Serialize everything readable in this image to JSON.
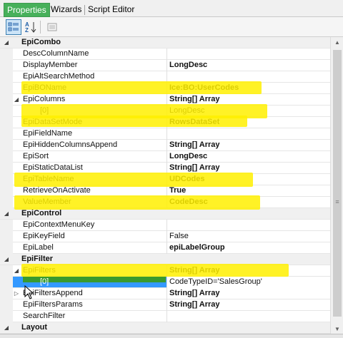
{
  "tabs": [
    {
      "label": "Properties",
      "active": true
    },
    {
      "label": "Wizards",
      "active": false
    },
    {
      "label": "Script Editor",
      "active": false
    }
  ],
  "toolbar": {
    "categorized_icon": "categorized-view-icon",
    "alphabetical_icon": "sort-az-icon",
    "pages_icon": "property-pages-icon"
  },
  "categories": {
    "epicombo": "EpiCombo",
    "epicontrol": "EpiControl",
    "epifilter": "EpiFilter",
    "layout": "Layout"
  },
  "props": {
    "desc_column_name": {
      "name": "DescColumnName",
      "value": ""
    },
    "display_member": {
      "name": "DisplayMember",
      "value": "LongDesc"
    },
    "epi_alt_search_method": {
      "name": "EpiAltSearchMethod",
      "value": ""
    },
    "epi_bo_name": {
      "name": "EpiBOName",
      "value": "Ice:BO:UserCodes"
    },
    "epi_columns": {
      "name": "EpiColumns",
      "value": "String[] Array"
    },
    "epi_columns_0": {
      "name": "[0]",
      "value": "LongDesc"
    },
    "epi_dataset_mode": {
      "name": "EpiDataSetMode",
      "value": "RowsDataSet"
    },
    "epi_field_name": {
      "name": "EpiFieldName",
      "value": ""
    },
    "epi_hidden_columns_append": {
      "name": "EpiHiddenColumnsAppend",
      "value": "String[] Array"
    },
    "epi_sort": {
      "name": "EpiSort",
      "value": "LongDesc"
    },
    "epi_static_data_list": {
      "name": "EpiStaticDataList",
      "value": "String[] Array"
    },
    "epi_table_name": {
      "name": "EpiTableName",
      "value": "UDCodes"
    },
    "retrieve_on_activate": {
      "name": "RetrieveOnActivate",
      "value": "True"
    },
    "value_member": {
      "name": "ValueMember",
      "value": "CodeDesc"
    },
    "epi_context_menu_key": {
      "name": "EpiContextMenuKey",
      "value": ""
    },
    "epi_key_field": {
      "name": "EpiKeyField",
      "value": "False"
    },
    "epi_label": {
      "name": "EpiLabel",
      "value": "epiLabelGroup"
    },
    "epi_filters": {
      "name": "EpiFilters",
      "value": "String[] Array"
    },
    "epi_filters_0": {
      "name": "[0]",
      "value": "CodeTypeID='SalesGroup'"
    },
    "epi_filters_append": {
      "name": "EpiFiltersAppend",
      "value": "String[] Array"
    },
    "epi_filters_params": {
      "name": "EpiFiltersParams",
      "value": "String[] Array"
    },
    "search_filter": {
      "name": "SearchFilter",
      "value": ""
    }
  },
  "colors": {
    "active_tab": "#47b05a",
    "highlight": "#fff000",
    "selection_green": "#3a9a2e",
    "selection_blue": "#3399ff"
  }
}
